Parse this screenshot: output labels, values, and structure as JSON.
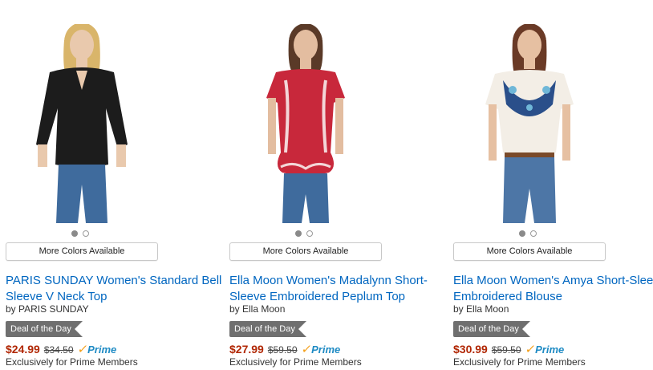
{
  "products": [
    {
      "title": "PARIS SUNDAY Women's Standard Bell Sleeve V Neck Top",
      "byline": "by PARIS SUNDAY",
      "more_colors": "More Colors Available",
      "deal_badge": "Deal of the Day",
      "price": "$24.99",
      "list_price": "$34.50",
      "prime_label": "Prime",
      "prime_note": "Exclusively for Prime Members",
      "image_colors": {
        "top": "#1c1c1c",
        "jeans": "#3f6b9d",
        "skin": "#e9c9ad",
        "hair": "#d9b56a"
      },
      "carousel_active_index": 0,
      "carousel_count": 2
    },
    {
      "title": "Ella Moon Women's Madalynn Short-Sleeve Embroidered Peplum Top",
      "byline": "by Ella Moon",
      "more_colors": "More Colors Available",
      "deal_badge": "Deal of the Day",
      "price": "$27.99",
      "list_price": "$59.50",
      "prime_label": "Prime",
      "prime_note": "Exclusively for Prime Members",
      "image_colors": {
        "top": "#c8283b",
        "jeans": "#3f6b9d",
        "skin": "#e3bda0",
        "hair": "#5a3a28"
      },
      "carousel_active_index": 0,
      "carousel_count": 2
    },
    {
      "title": "Ella Moon Women's Amya Short-Sleeve Embroidered Blouse",
      "byline": "by Ella Moon",
      "more_colors": "More Colors Available",
      "deal_badge": "Deal of the Day",
      "price": "$30.99",
      "list_price": "$59.50",
      "prime_label": "Prime",
      "prime_note": "Exclusively for Prime Members",
      "image_colors": {
        "top": "#f3eee6",
        "jeans": "#4d76a6",
        "skin": "#e6c0a2",
        "hair": "#6a3a26"
      },
      "carousel_active_index": 0,
      "carousel_count": 2
    }
  ],
  "colors": {
    "link": "#0066c0",
    "price": "#b12704",
    "deal_bg": "#6f6f6f",
    "prime_blue": "#1f8bc4",
    "prime_check": "#f39c12"
  }
}
